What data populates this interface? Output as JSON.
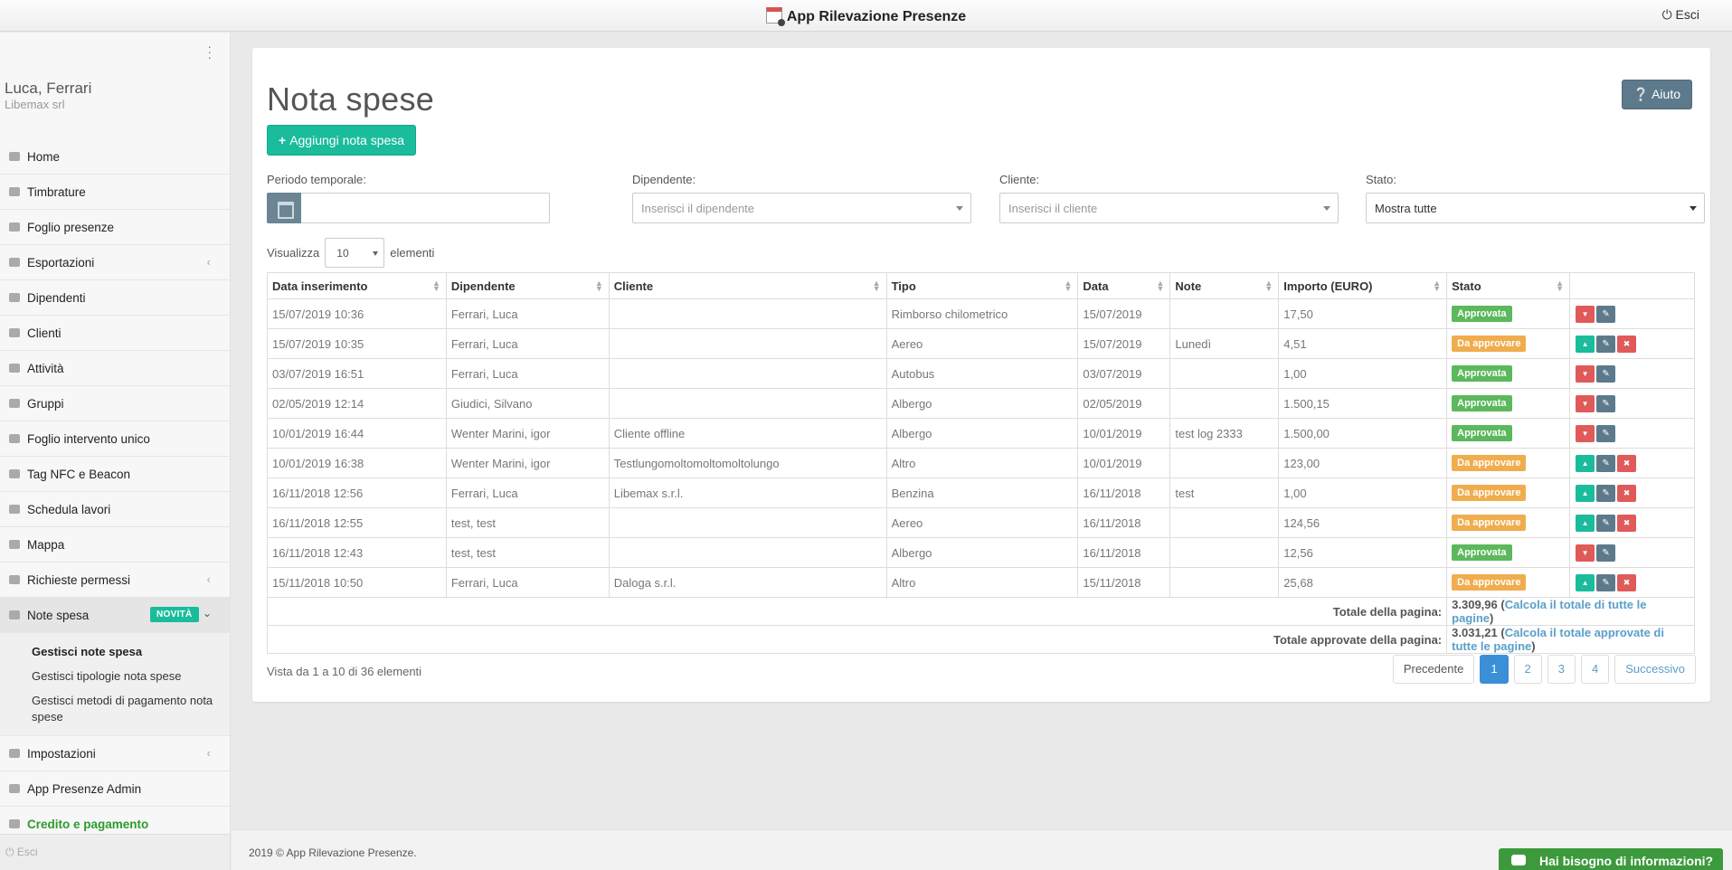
{
  "app": {
    "title": "App Rilevazione Presenze",
    "logout_top": "⏻ Esci"
  },
  "user": {
    "name": "Luca, Ferrari",
    "company": "Libemax srl"
  },
  "sidebar": {
    "items": [
      {
        "label": "Home"
      },
      {
        "label": "Timbrature"
      },
      {
        "label": "Foglio presenze"
      },
      {
        "label": "Esportazioni",
        "chevron": "‹"
      },
      {
        "label": "Dipendenti"
      },
      {
        "label": "Clienti"
      },
      {
        "label": "Attività"
      },
      {
        "label": "Gruppi"
      },
      {
        "label": "Foglio intervento unico"
      },
      {
        "label": "Tag NFC e Beacon"
      },
      {
        "label": "Schedula lavori"
      },
      {
        "label": "Mappa"
      },
      {
        "label": "Richieste permessi",
        "chevron": "‹"
      }
    ],
    "note_spesa": {
      "label": "Note spesa",
      "badge": "NOVITÀ",
      "chevron": "⌄"
    },
    "subitems": [
      {
        "label": "Gestisci note spesa"
      },
      {
        "label": "Gestisci tipologie nota spese"
      },
      {
        "label": "Gestisci metodi di pagamento nota spese"
      }
    ],
    "bottom_items": [
      {
        "label": "Impostazioni",
        "chevron": "‹"
      },
      {
        "label": "App Presenze Admin"
      },
      {
        "label": "Credito e pagamento"
      }
    ],
    "logout": "⏻ Esci"
  },
  "page": {
    "title": "Nota spese",
    "help_button": "Aiuto",
    "add_button": "Aggiungi nota spesa"
  },
  "filters": {
    "period_label": "Periodo temporale:",
    "employee_label": "Dipendente:",
    "employee_placeholder": "Inserisci il dipendente",
    "client_label": "Cliente:",
    "client_placeholder": "Inserisci il cliente",
    "status_label": "Stato:",
    "status_value": "Mostra tutte"
  },
  "length": {
    "prefix": "Visualizza",
    "value": "10",
    "suffix": "elementi"
  },
  "table": {
    "columns": [
      "Data inserimento",
      "Dipendente",
      "Cliente",
      "Tipo",
      "Data",
      "Note",
      "Importo (EURO)",
      "Stato"
    ],
    "rows": [
      {
        "inserted": "15/07/2019 10:36",
        "employee": "Ferrari, Luca",
        "client": "",
        "type": "Rimborso chilometrico",
        "date": "15/07/2019",
        "note": "",
        "amount": "17,50",
        "status": "Approvata",
        "approved": true
      },
      {
        "inserted": "15/07/2019 10:35",
        "employee": "Ferrari, Luca",
        "client": "",
        "type": "Aereo",
        "date": "15/07/2019",
        "note": "Lunedì",
        "amount": "4,51",
        "status": "Da approvare",
        "approved": false
      },
      {
        "inserted": "03/07/2019 16:51",
        "employee": "Ferrari, Luca",
        "client": "",
        "type": "Autobus",
        "date": "03/07/2019",
        "note": "",
        "amount": "1,00",
        "status": "Approvata",
        "approved": true
      },
      {
        "inserted": "02/05/2019 12:14",
        "employee": "Giudici, Silvano",
        "client": "",
        "type": "Albergo",
        "date": "02/05/2019",
        "note": "",
        "amount": "1.500,15",
        "status": "Approvata",
        "approved": true
      },
      {
        "inserted": "10/01/2019 16:44",
        "employee": "Wenter Marini, igor",
        "client": "Cliente offline",
        "type": "Albergo",
        "date": "10/01/2019",
        "note": "test log 2333",
        "amount": "1.500,00",
        "status": "Approvata",
        "approved": true
      },
      {
        "inserted": "10/01/2019 16:38",
        "employee": "Wenter Marini, igor",
        "client": "Testlungomoltomoltomoltolungo",
        "type": "Altro",
        "date": "10/01/2019",
        "note": "",
        "amount": "123,00",
        "status": "Da approvare",
        "approved": false
      },
      {
        "inserted": "16/11/2018 12:56",
        "employee": "Ferrari, Luca",
        "client": "Libemax s.r.l.",
        "type": "Benzina",
        "date": "16/11/2018",
        "note": "test",
        "amount": "1,00",
        "status": "Da approvare",
        "approved": false
      },
      {
        "inserted": "16/11/2018 12:55",
        "employee": "test, test",
        "client": "",
        "type": "Aereo",
        "date": "16/11/2018",
        "note": "",
        "amount": "124,56",
        "status": "Da approvare",
        "approved": false
      },
      {
        "inserted": "16/11/2018 12:43",
        "employee": "test, test",
        "client": "",
        "type": "Albergo",
        "date": "16/11/2018",
        "note": "",
        "amount": "12,56",
        "status": "Approvata",
        "approved": true
      },
      {
        "inserted": "15/11/2018 10:50",
        "employee": "Ferrari, Luca",
        "client": "Daloga s.r.l.",
        "type": "Altro",
        "date": "15/11/2018",
        "note": "",
        "amount": "25,68",
        "status": "Da approvare",
        "approved": false
      }
    ],
    "total_page_label": "Totale della pagina:",
    "total_page_value": "3.309,96",
    "total_page_link": "Calcola il totale di tutte le pagine",
    "total_approved_label": "Totale approvate della pagina:",
    "total_approved_value": "3.031,21",
    "total_approved_link": "Calcola il totale approvate di tutte le pagine"
  },
  "pagination": {
    "info": "Vista da 1 a 10 di 36 elementi",
    "prev": "Precedente",
    "pages": [
      "1",
      "2",
      "3",
      "4"
    ],
    "current": "1",
    "next": "Successivo"
  },
  "footer": {
    "text": "2019 © App Rilevazione Presenze.",
    "chat": "Hai bisogno di informazioni?"
  },
  "colors": {
    "accent": "#1abc9c",
    "approved": "#5cb85c",
    "pending": "#f0ad4e",
    "danger": "#e05a5a",
    "slate": "#5d7a8c"
  }
}
